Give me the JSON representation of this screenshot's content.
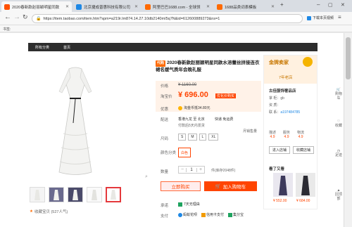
{
  "browser": {
    "tabs": [
      {
        "label": "2020春新款赵丽颖明星同款",
        "active": true,
        "color": "#ff5000"
      },
      {
        "label": "北京捷成普惠科技有限公司",
        "active": false,
        "color": "#1e88e5"
      },
      {
        "label": "阿里巴巴1688.com - 全球领",
        "active": false,
        "color": "#ff6a00"
      },
      {
        "label": "1688品类词表模板",
        "active": false,
        "color": "#ff6a00"
      }
    ],
    "url": "https://item.taobao.com/item.htm?spm=a219r.lm874.14.27.10db2140mI5q7N&id=612600889273&ns=1",
    "download_label": "下载本页视频",
    "bookmarks_label": "书签:"
  },
  "store_nav": {
    "items": [
      "所有分类",
      "首页"
    ]
  },
  "product": {
    "tag": "代购",
    "title": "2020春新款赵丽颖明星同款水溶蕾丝拼接连衣裙名媛气质年会晚礼服",
    "price_label": "价格",
    "original_price": "¥ 1160.00",
    "promo_label": "淘宝价",
    "promo_price": "¥ 696.00",
    "promo_tag": "优化价购买",
    "offer_label": "优惠",
    "offer_text": "淘金币抵34.80元",
    "delivery_label": "配送",
    "delivery_text": "香港九龙 至 北京",
    "delivery_fee": "快递 免运费",
    "delivery_note": "付款后5天内发货",
    "reviews_badge": "月销售量",
    "size_label": "尺码",
    "sizes": [
      "S",
      "M",
      "L",
      "XL"
    ],
    "color_label": "颜色分类",
    "color_value": "白色",
    "qty_label": "数量",
    "qty": "1",
    "stock": "件(库存2048件)",
    "buy_now": "立即购买",
    "add_cart": "加入购物车",
    "service_label": "承诺",
    "service_text": "7天无理由",
    "pay_label": "支付",
    "pay_options": [
      "蚂蚁花呗",
      "信用卡支付",
      "集分宝"
    ],
    "favorite": "收藏宝贝 (527人气)"
  },
  "shop": {
    "medal": "金牌卖家",
    "years": "7年老店",
    "name": "古佳服饰奢品店",
    "seller_label": "掌 柜：",
    "seller_value": "gb",
    "qual_label": "资 质：",
    "contact_label": "联 系：",
    "phone_label": "a197484785",
    "scores": [
      {
        "label": "描述",
        "value": "4.9"
      },
      {
        "label": "服务",
        "value": "4.9"
      },
      {
        "label": "物流",
        "value": "4.9"
      }
    ],
    "enter_shop": "进入店铺",
    "fav_shop": "收藏店铺",
    "recommend_title": "看了又看",
    "rec_prices": [
      "¥ 552.00",
      "¥ 684.00"
    ]
  },
  "right_bar": [
    "购物车",
    "收藏",
    "足迹",
    "回顶部"
  ]
}
